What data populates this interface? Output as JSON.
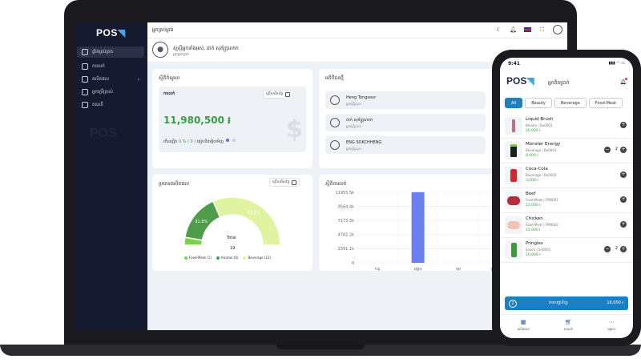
{
  "desktop": {
    "brand": "POS",
    "sidebar": {
      "items": [
        {
          "label": "ផ្ទាំងគ្រប់គ្រង",
          "icon": "dashboard-icon"
        },
        {
          "label": "ការលក់",
          "icon": "cart-icon"
        },
        {
          "label": "ផលិតផល",
          "icon": "box-icon"
        },
        {
          "label": "អ្នកប្រើប្រាស់",
          "icon": "users-icon"
        },
        {
          "label": "គណនី",
          "icon": "account-icon"
        }
      ]
    },
    "topbar": {
      "title": "អ្នកគ្រប់គ្រង"
    },
    "user": {
      "name": "សួស្ដីអ្នកទាំងអស់, ដាក់ សុភ័ក្ត្រលោក",
      "role": "អ្នកគ្រប់គ្រង"
    },
    "revenue_card": {
      "title": "ស្ថិតិចំណូល",
      "inner_label": "ការលក់",
      "date_btn": "ជ្រើសរើសថ្ងៃ",
      "value": "11,980,500 ៛",
      "change_prefix": "កើនឡើង",
      "change_pct": "0 % ( 0 )",
      "change_suffix": "ធៀបនឹងម្សិលមិញ"
    },
    "customers_card": {
      "title": "អតិថិជនថ្មី",
      "date_btn": "ជ្រើសរើសថ្ងៃ",
      "rows": [
        {
          "name": "Heng Tongsour",
          "role": "អ្នកប្រើប្រាស់"
        },
        {
          "name": "ដាក់ សុភ័ក្ត្រលោក",
          "role": "អ្នកប្រើប្រាស់"
        },
        {
          "name": "ENG SOKCHHENG",
          "role": "អ្នកប្រើប្រាស់"
        }
      ]
    },
    "category_card": {
      "title": "ប្រភេទផលិតផល",
      "date_btn": "ជ្រើសរើសថ្ងៃ",
      "total_label": "Total",
      "total_value": "19"
    },
    "sales_card": {
      "title": "ស្ថិតិការលក់"
    }
  },
  "chart_data": [
    {
      "type": "pie",
      "categories": [
        "Food-Meat",
        "Alcohol",
        "Beverage"
      ],
      "counts": [
        1,
        6,
        12
      ],
      "values_pct": [
        5.3,
        31.6,
        63.2
      ],
      "labels_shown": [
        "31.6%",
        "63.2%"
      ],
      "legend": [
        "Food-Meat (1)",
        "Alcohol (6)",
        "Beverage (12)"
      ],
      "colors": [
        "#7ad24a",
        "#4f9d4a",
        "#dff3a0"
      ],
      "legend_position": "bottom"
    },
    {
      "type": "bar",
      "categories": [
        "ចន្ទ",
        "អង្គារ",
        "ពុធ",
        "ព្រហស្បតិ៍",
        "សុក្រ"
      ],
      "values": [
        0,
        11980.5,
        0,
        0,
        0
      ],
      "ytick_labels": [
        "0",
        "2391.1k",
        "4782.2k",
        "7173.3k",
        "9564.4k",
        "11955.5k"
      ],
      "ylim": [
        0,
        11955.5
      ],
      "grid": true,
      "color": "#6b7ff0"
    }
  ],
  "phone": {
    "time": "9:41",
    "brand": "POS",
    "title": "អ្នកគិតប្រាក់",
    "filters": [
      "All",
      "Beauty",
      "Beverage",
      "Food-Meat"
    ],
    "products": [
      {
        "name": "Liquid Brush",
        "meta": "Beauty | Bu0001",
        "price": "20,000 ៛",
        "qty": ""
      },
      {
        "name": "Monster Energy",
        "meta": "Beverage | Be0001",
        "price": "8,000 ៛",
        "qty": "2"
      },
      {
        "name": "Coca-Cola",
        "meta": "Beverage | Be0002",
        "price": "3,000 ៛",
        "qty": ""
      },
      {
        "name": "Beef",
        "meta": "Food-Meat | FM0001",
        "price": "22,000 ៛",
        "qty": ""
      },
      {
        "name": "Chicken",
        "meta": "Food-Meat | FM0002",
        "price": "15,000 ៛",
        "qty": ""
      },
      {
        "name": "Pringles",
        "meta": "Snack | Sn0001",
        "price": "10,000 ៛",
        "qty": "2"
      }
    ],
    "checkout": {
      "count": "2",
      "label": "ការបញ្ជាទិញ",
      "total": "18,000 ៛"
    },
    "tabs": [
      {
        "label": "ផលិតផល",
        "icon": "store-icon"
      },
      {
        "label": "ការលក់",
        "icon": "cart-icon"
      },
      {
        "label": "ផ្សេងៗ",
        "icon": "more-icon"
      }
    ]
  }
}
